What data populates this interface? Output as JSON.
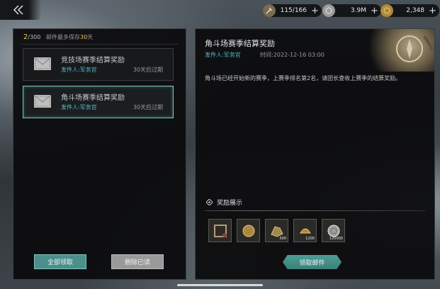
{
  "resources": [
    {
      "icon": "hammer-icon",
      "value": "115/166"
    },
    {
      "icon": "silver-coin-icon",
      "value": "3.9M"
    },
    {
      "icon": "gold-coin-icon",
      "value": "2,348"
    }
  ],
  "mailbox": {
    "count": "2",
    "total": "/300",
    "note_prefix": "邮件最多保存",
    "note_days": "30",
    "note_suffix": "天",
    "mails": [
      {
        "title": "竞技场赛季结算奖励",
        "sender": "发件人:军务官",
        "expire": "30天后过期"
      },
      {
        "title": "角斗场赛季结算奖励",
        "sender": "发件人:军务官",
        "expire": "30天后过期"
      }
    ],
    "claim_all_label": "全部领取",
    "delete_read_label": "删除已读"
  },
  "detail": {
    "title": "角斗场赛季结算奖励",
    "sender": "发件人:军务官",
    "time": "时间:2022-12-16 03:00",
    "body": "角斗场已经开始新的赛季，上赛季排名第2名，请团长查收上赛季的结算奖励。",
    "reward_header": "奖励展示",
    "rewards": [
      {
        "icon": "frame-item-icon",
        "qty": ""
      },
      {
        "icon": "gold-medal-icon",
        "qty": ""
      },
      {
        "icon": "ore-icon",
        "qty": "500"
      },
      {
        "icon": "helmet-icon",
        "qty": "1200"
      },
      {
        "icon": "silver-coin-icon",
        "qty": "120000"
      }
    ],
    "claim_label": "领取邮件"
  },
  "colors": {
    "accent": "#4a8f8a",
    "sender": "#5fb7c9",
    "highlight": "#e8c46a"
  }
}
